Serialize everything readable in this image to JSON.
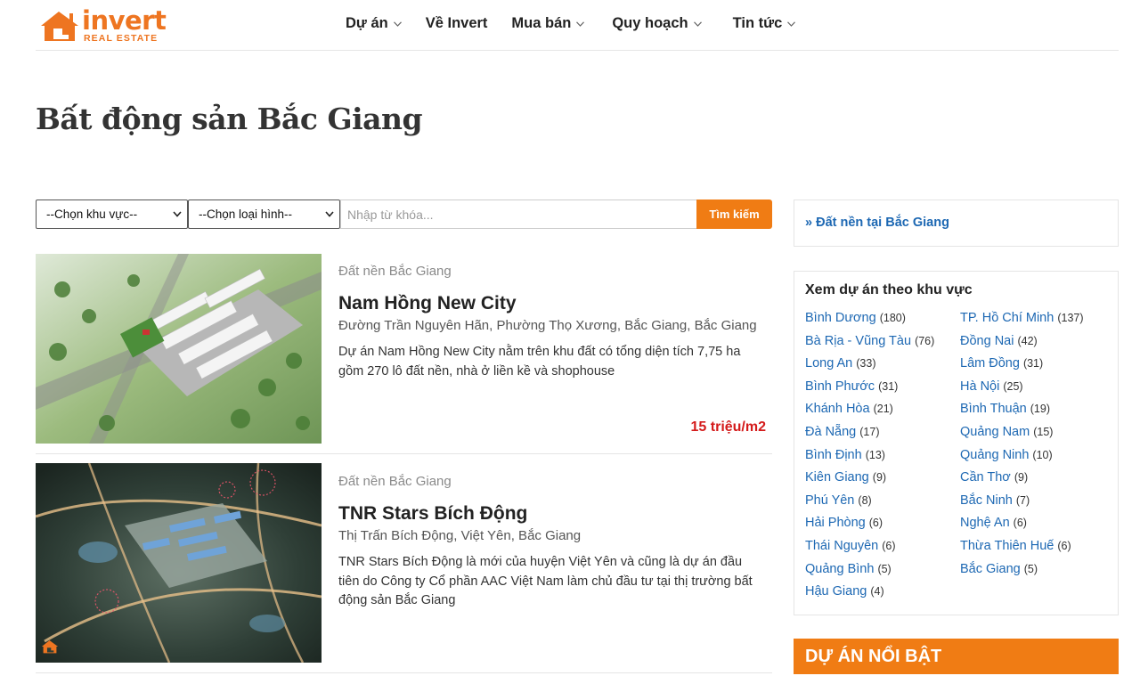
{
  "header": {
    "logo_word": "invert",
    "logo_sub": "REAL ESTATE",
    "nav": [
      {
        "label": "Dự án"
      },
      {
        "label": "Về Invert"
      },
      {
        "label": "Mua bán"
      },
      {
        "label": "Quy hoạch"
      },
      {
        "label": "Tin tức"
      }
    ]
  },
  "page": {
    "title": "Bất động sản Bắc Giang"
  },
  "search": {
    "region_select": "--Chọn khu vực--",
    "type_select": "--Chọn loại hình--",
    "keyword_placeholder": "Nhập từ khóa...",
    "button": "Tìm kiếm"
  },
  "listings": [
    {
      "category": "Đất nền Bắc Giang",
      "title": "Nam Hồng New City",
      "address": "Đường Trần Nguyên Hãn, Phường Thọ Xương, Bắc Giang, Bắc Giang",
      "description": "Dự án Nam Hồng New City nằm trên khu đất có tổng diện tích 7,75 ha gồm 270 lô đất nền, nhà ở liền kề và shophouse",
      "price": "15 triệu/m2"
    },
    {
      "category": "Đất nền Bắc Giang",
      "title": "TNR Stars Bích Động",
      "address": "Thị Trấn Bích Động, Việt Yên, Bắc Giang",
      "description": "TNR Stars Bích Động là mới của huyện Việt Yên và cũng là dự án đầu tiên do Công ty Cổ phần AAC Việt Nam làm chủ đầu tư tại thị trường bất động sản Bắc Giang",
      "price": ""
    }
  ],
  "sidebar": {
    "related_link": "» Đất nền tại Bắc Giang",
    "regions_title": "Xem dự án theo khu vực",
    "regions": [
      {
        "name": "Bình Dương",
        "count": "(180)"
      },
      {
        "name": "TP. Hồ Chí Minh",
        "count": "(137)"
      },
      {
        "name": "Bà Rịa - Vũng Tàu",
        "count": "(76)"
      },
      {
        "name": "Đồng Nai",
        "count": "(42)"
      },
      {
        "name": "Long An",
        "count": "(33)"
      },
      {
        "name": "Lâm Đồng",
        "count": "(31)"
      },
      {
        "name": "Bình Phước",
        "count": "(31)"
      },
      {
        "name": "Hà Nội",
        "count": "(25)"
      },
      {
        "name": "Khánh Hòa",
        "count": "(21)"
      },
      {
        "name": "Bình Thuận",
        "count": "(19)"
      },
      {
        "name": "Đà Nẵng",
        "count": "(17)"
      },
      {
        "name": "Quảng Nam",
        "count": "(15)"
      },
      {
        "name": "Bình Định",
        "count": "(13)"
      },
      {
        "name": "Quảng Ninh",
        "count": "(10)"
      },
      {
        "name": "Kiên Giang",
        "count": "(9)"
      },
      {
        "name": "Cần Thơ",
        "count": "(9)"
      },
      {
        "name": "Phú Yên",
        "count": "(8)"
      },
      {
        "name": "Bắc Ninh",
        "count": "(7)"
      },
      {
        "name": "Hải Phòng",
        "count": "(6)"
      },
      {
        "name": "Nghệ An",
        "count": "(6)"
      },
      {
        "name": "Thái Nguyên",
        "count": "(6)"
      },
      {
        "name": "Thừa Thiên Huế",
        "count": "(6)"
      },
      {
        "name": "Quảng Bình",
        "count": "(5)"
      },
      {
        "name": "Bắc Giang",
        "count": "(5)"
      },
      {
        "name": "Hậu Giang",
        "count": "(4)"
      }
    ],
    "featured_title": "DỰ ÁN NỔI BẬT"
  },
  "colors": {
    "brand_orange": "#f07c14",
    "link_blue": "#1d68b3",
    "price_red": "#d41b1b"
  }
}
